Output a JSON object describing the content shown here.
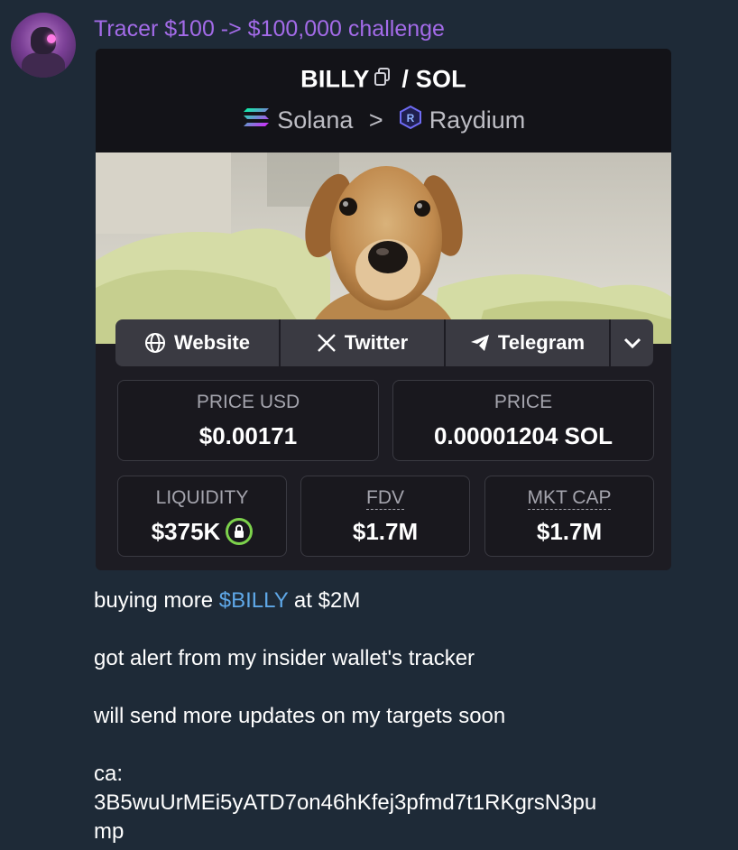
{
  "message": {
    "author": "Tracer $100 -> $100,000 challenge",
    "avatar_icon": "robot-avatar-icon"
  },
  "card": {
    "pair_base": "BILLY",
    "pair_sep": "/",
    "pair_quote": "SOL",
    "chain": "Solana",
    "chain_sep": ">",
    "dex": "Raydium",
    "links": [
      {
        "label": "Website",
        "icon": "globe-icon"
      },
      {
        "label": "Twitter",
        "icon": "x-icon"
      },
      {
        "label": "Telegram",
        "icon": "telegram-icon"
      }
    ],
    "stats_row1": [
      {
        "label": "PRICE USD",
        "value": "$0.00171"
      },
      {
        "label": "PRICE",
        "value": "0.00001204 SOL"
      }
    ],
    "stats_row2": [
      {
        "label": "LIQUIDITY",
        "value": "$375K"
      },
      {
        "label": "FDV",
        "value": "$1.7M"
      },
      {
        "label": "MKT CAP",
        "value": "$1.7M"
      }
    ],
    "colors": {
      "accent_green": "#7dd24c",
      "author_purple": "#a36be8",
      "link_blue": "#5fa8e8"
    }
  },
  "body": {
    "line1_pre": "buying more ",
    "line1_token": "$BILLY",
    "line1_post": " at $2M",
    "line2": "got alert from my insider wallet's tracker",
    "line3": "will send more updates on my targets soon",
    "line4": "ca:",
    "line5": "3B5wuUrMEi5yATD7on46hKfej3pfmd7t1RKgrsN3pu",
    "line6": "mp"
  }
}
